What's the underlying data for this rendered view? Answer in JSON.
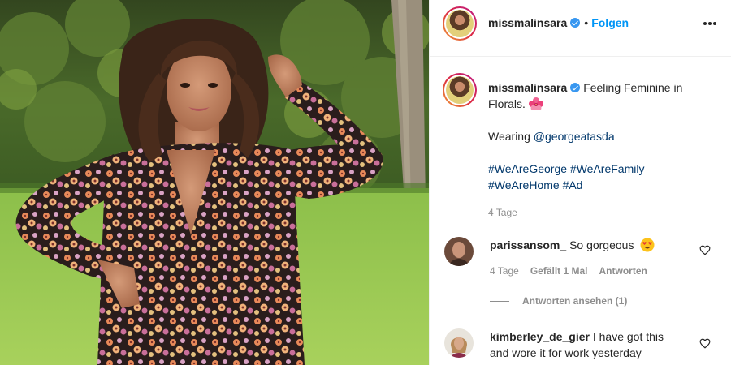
{
  "post": {
    "username": "missmalinsara",
    "follow_label": "Folgen",
    "separator": "•"
  },
  "caption": {
    "username": "missmalinsara",
    "text_line1": "Feeling Feminine in Florals.",
    "wearing_prefix": "Wearing ",
    "mention": "@georgeatasda",
    "hashtags": [
      "#WeAreGeorge",
      "#WeAreFamily",
      "#WeAreHome",
      "#Ad"
    ],
    "time": "4 Tage"
  },
  "comments": [
    {
      "username": "parissansom_",
      "text": "So gorgeous",
      "time": "4 Tage",
      "likes": "Gefällt 1 Mal",
      "reply_label": "Antworten",
      "view_replies": "Antworten ansehen (1)"
    },
    {
      "username": "kimberley_de_gier",
      "text": "I have got this and wore it for work yesterday"
    }
  ],
  "colors": {
    "verified": "#3897f0",
    "follow": "#0095f6",
    "link": "#00376b",
    "muted": "#8e8e8e"
  },
  "icons": [
    "verified-badge-icon",
    "more-options-icon",
    "hibiscus-emoji-icon",
    "heart-eyes-emoji-icon",
    "heart-icon"
  ]
}
